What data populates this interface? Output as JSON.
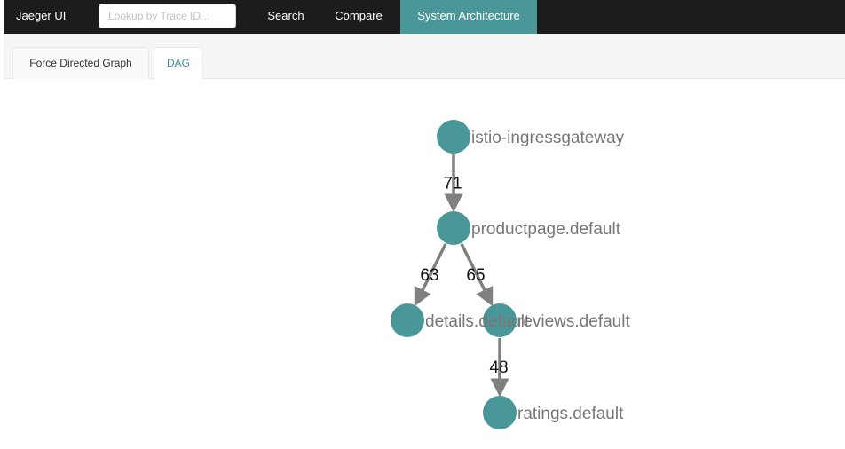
{
  "topbar": {
    "brand": "Jaeger UI",
    "search_placeholder": "Lookup by Trace ID...",
    "nav": {
      "search": "Search",
      "compare": "Compare",
      "system_architecture": "System Architecture"
    }
  },
  "tabs": {
    "force_directed": "Force Directed Graph",
    "dag": "DAG",
    "active": "DAG"
  },
  "graph": {
    "node_color": "#4a9799",
    "edge_color": "#808080",
    "nodes": [
      {
        "id": "istio",
        "label": "istio-ingressgateway"
      },
      {
        "id": "productpage",
        "label": "productpage.default"
      },
      {
        "id": "details",
        "label": "details.default"
      },
      {
        "id": "reviews",
        "label": "reviews.default"
      },
      {
        "id": "ratings",
        "label": "ratings.default"
      }
    ],
    "edges": [
      {
        "from": "istio",
        "to": "productpage",
        "count": "71"
      },
      {
        "from": "productpage",
        "to": "details",
        "count": "63"
      },
      {
        "from": "productpage",
        "to": "reviews",
        "count": "65"
      },
      {
        "from": "reviews",
        "to": "ratings",
        "count": "48"
      }
    ]
  }
}
